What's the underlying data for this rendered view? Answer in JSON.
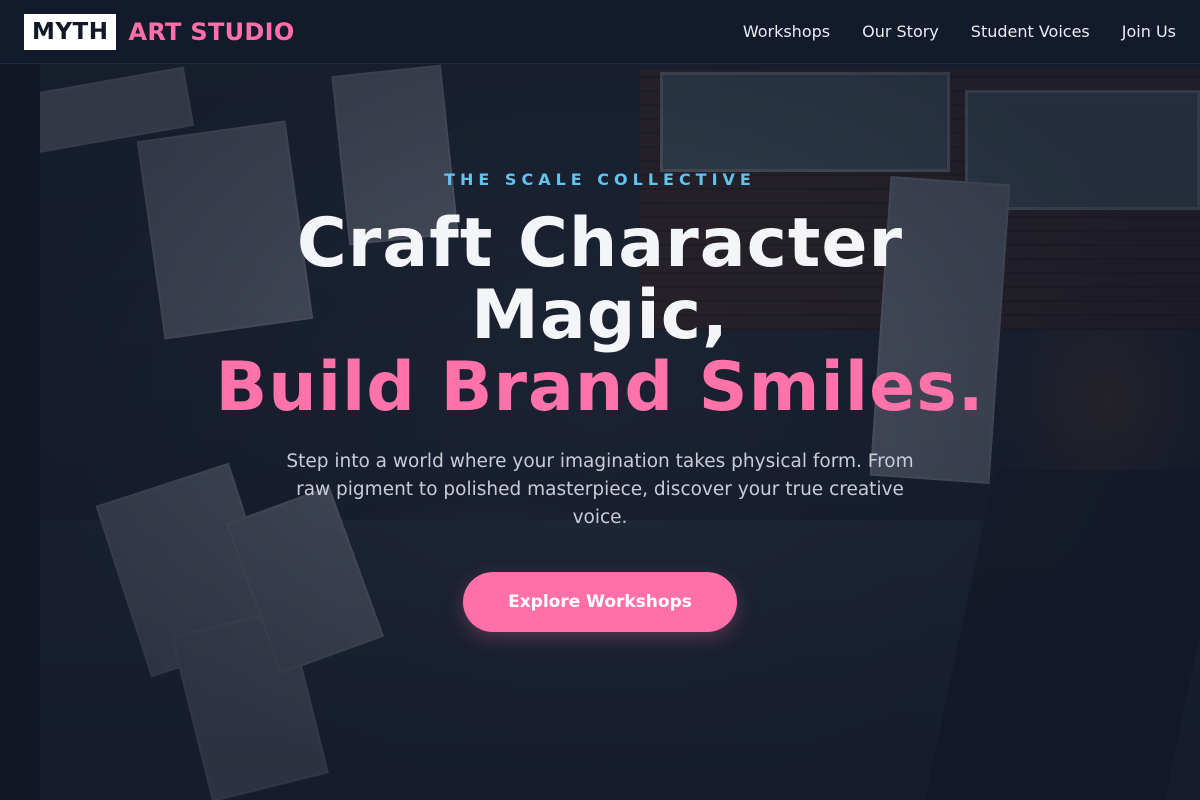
{
  "brand": {
    "box": "MYTH",
    "name": "ART STUDIO"
  },
  "nav": {
    "items": [
      "Workshops",
      "Our Story",
      "Student Voices",
      "Join Us"
    ]
  },
  "hero": {
    "eyebrow": "THE SCALE COLLECTIVE",
    "headline_line1": "Craft Character",
    "headline_line2": "Magic,",
    "headline_line3": "Build Brand Smiles.",
    "subtext": "Step into a world where your imagination takes physical form. From raw pigment to polished masterpiece, discover your true creative voice.",
    "cta_label": "Explore Workshops"
  },
  "colors": {
    "accent": "#ff6fa8",
    "eyebrow": "#5fc4f0",
    "navbar": "#141a2c"
  }
}
